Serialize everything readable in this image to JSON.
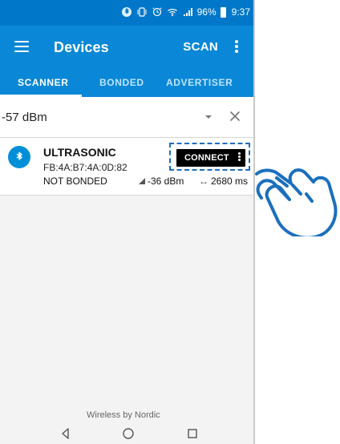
{
  "status_bar": {
    "battery_percent": "96%",
    "time": "9:37"
  },
  "app_bar": {
    "title": "Devices",
    "scan_label": "SCAN"
  },
  "tabs": [
    {
      "label": "SCANNER",
      "active": true
    },
    {
      "label": "BONDED",
      "active": false
    },
    {
      "label": "ADVERTISER",
      "active": false
    }
  ],
  "filter": {
    "value": "-57 dBm"
  },
  "devices": [
    {
      "name": "ULTRASONIC",
      "address": "FB:4A:B7:4A:0D:82",
      "bond_status": "NOT BONDED",
      "rssi": "-36 dBm",
      "interval": "2680 ms",
      "action_label": "CONNECT"
    }
  ],
  "footer": {
    "text": "Wireless by Nordic"
  },
  "icons": {
    "menu": "menu-icon",
    "more": "kebab-icon",
    "dropdown": "dropdown-icon",
    "clear": "close-icon",
    "device": "bluetooth-icon",
    "back": "back-icon",
    "home": "home-icon",
    "recent": "recent-apps-icon",
    "hand": "pointing-hand-icon"
  },
  "colors": {
    "status_bar": "#0077c8",
    "app_bar": "#0a88d7",
    "tab_text": "#bfe3ff",
    "tab_active": "#ffffff",
    "highlight": "#1b6fbe",
    "button": "#000000"
  }
}
